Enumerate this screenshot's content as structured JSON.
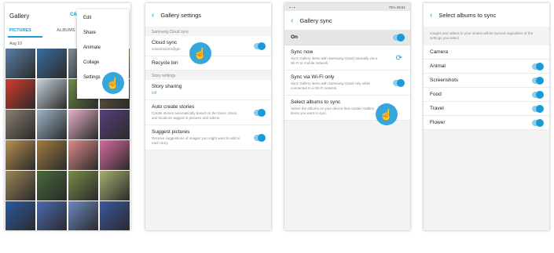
{
  "colors": {
    "accent": "#1a9ad6",
    "toggle_track": "#8ccff0"
  },
  "panel1": {
    "title": "Gallery",
    "tab_partial": "CA",
    "tabs": [
      "PICTURES",
      "ALBUMS"
    ],
    "date": "Aug 10",
    "menu": [
      "Edit",
      "Share",
      "Animate",
      "Collage",
      "Settings"
    ],
    "thumb_colors": [
      "#5a7fa8",
      "#3a6da0",
      "#7a8a94",
      "#e0c56a",
      "#d43b2b",
      "#c8d2dc",
      "#6f8e44",
      "#6e5c48",
      "#8a7e70",
      "#a0b4c8",
      "#e6b0c8",
      "#58407a",
      "#b89050",
      "#a07b40",
      "#e08a88",
      "#d86aa0",
      "#9c8458",
      "#486a3a",
      "#7a8c4a",
      "#a6b070",
      "#2a5aa0",
      "#4a6ab0",
      "#6a88c0",
      "#3a58a0",
      "#3a7ab8",
      "#c4c0d8"
    ]
  },
  "panel2": {
    "title": "Gallery settings",
    "section_cloud": "Samsung Cloud sync",
    "cloud_sync_label": "Cloud sync",
    "cloud_sync_account": "solovib11123@gm",
    "recycle_label": "Recycle bin",
    "section_story": "Story settings",
    "story_sharing_label": "Story sharing",
    "story_sharing_value": "Off",
    "auto_label": "Auto create stories",
    "auto_desc": "Create stories automatically based on the faces, times, and locations tagged in pictures and videos.",
    "suggest_label": "Suggest pictures",
    "suggest_desc": "Receive suggestions of images you might want to add to each story."
  },
  "panel3": {
    "status_right": "75% 09:51",
    "title": "Gallery sync",
    "on_label": "On",
    "sync_now_label": "Sync now",
    "sync_now_desc": "Sync Gallery items with Samsung Cloud manually via a Wi-Fi or mobile network.",
    "wifi_label": "Sync via Wi-Fi only",
    "wifi_desc": "Sync Gallery items with Samsung Cloud only while connected to a Wi-Fi network.",
    "albums_label": "Select albums to sync",
    "albums_desc": "Select the albums on your device that contain Gallery items you want to sync."
  },
  "panel4": {
    "title": "Select albums to sync",
    "description": "Images and videos in your stories will be synced regardless of the settings you select.",
    "camera_label": "Camera",
    "albums": [
      "Animal",
      "Screenshots",
      "Food",
      "Travel",
      "Flower"
    ]
  },
  "icons": {
    "back": "back-arrow-icon",
    "touch": "tap-hand-icon",
    "sync": "sync-icon"
  }
}
